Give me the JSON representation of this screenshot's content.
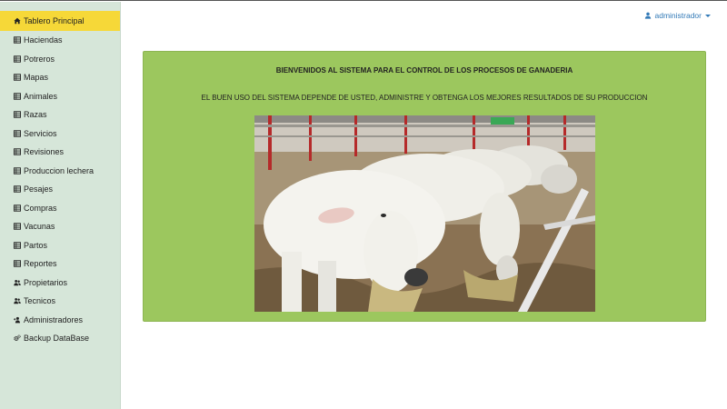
{
  "sidebar": {
    "items": [
      {
        "label": "Tablero Principal",
        "icon": "home-icon",
        "active": true
      },
      {
        "label": "Haciendas",
        "icon": "table-icon"
      },
      {
        "label": "Potreros",
        "icon": "table-icon"
      },
      {
        "label": "Mapas",
        "icon": "table-icon"
      },
      {
        "label": "Animales",
        "icon": "table-icon"
      },
      {
        "label": "Razas",
        "icon": "table-icon"
      },
      {
        "label": "Servicios",
        "icon": "table-icon"
      },
      {
        "label": "Revisiones",
        "icon": "table-icon"
      },
      {
        "label": "Produccion lechera",
        "icon": "table-icon"
      },
      {
        "label": "Pesajes",
        "icon": "table-icon"
      },
      {
        "label": "Compras",
        "icon": "table-icon"
      },
      {
        "label": "Vacunas",
        "icon": "table-icon"
      },
      {
        "label": "Partos",
        "icon": "table-icon"
      },
      {
        "label": "Reportes",
        "icon": "table-icon"
      },
      {
        "label": "Propietarios",
        "icon": "users-icon"
      },
      {
        "label": "Tecnicos",
        "icon": "users-icon"
      },
      {
        "label": "Administradores",
        "icon": "user-plus-icon"
      },
      {
        "label": "Backup DataBase",
        "icon": "cogs-icon"
      }
    ]
  },
  "header": {
    "user_label": "administrador",
    "user_icon": "user-icon"
  },
  "main": {
    "title": "BIENVENIDOS AL SISTEMA PARA EL CONTROL DE LOS PROCESOS DE GANADERIA",
    "subtitle": "EL BUEN USO DEL SISTEMA DEPENDE DE USTED, ADMINISTRE Y OBTENGA LOS MEJORES RESULTADOS DE SU PRODUCCION",
    "image_subject": "white cattle eating hay in a barn"
  },
  "colors": {
    "sidebar_bg": "#d6e6d9",
    "active_item": "#f6d838",
    "panel_bg": "#9cc75e",
    "link": "#337ab7"
  }
}
